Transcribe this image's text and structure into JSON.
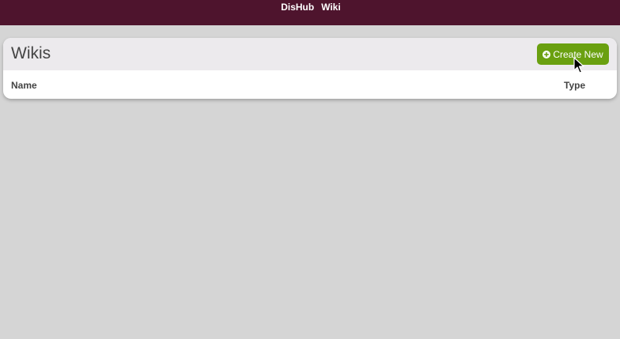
{
  "topbar": {
    "nav": [
      {
        "label": "DisHub"
      },
      {
        "label": "Wiki"
      }
    ]
  },
  "page": {
    "title": "Wikis",
    "create_button": {
      "label": "Create New",
      "icon": "plus-circle-icon"
    }
  },
  "table": {
    "columns": [
      {
        "label": "Name"
      },
      {
        "label": "Type"
      }
    ],
    "rows": []
  },
  "colors": {
    "topbar": "#4e142d",
    "accent": "#6aa010",
    "background": "#d5d5d5"
  }
}
